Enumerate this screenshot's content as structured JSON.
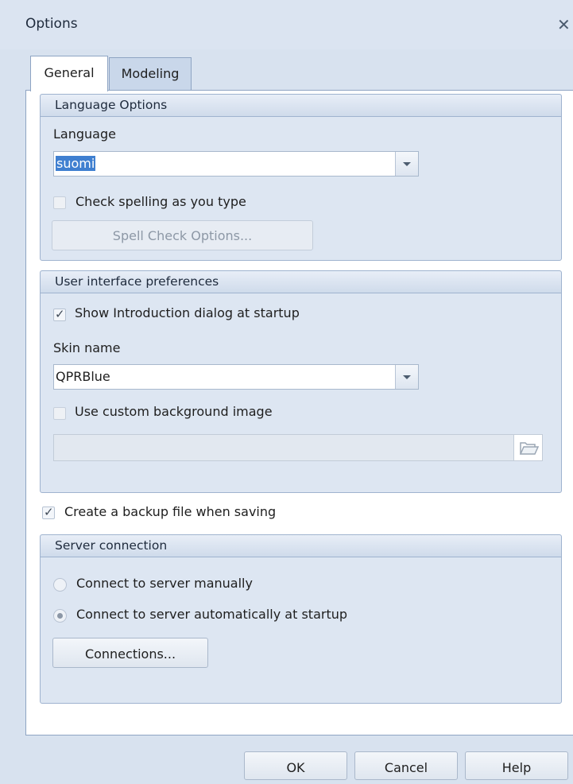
{
  "window": {
    "title": "Options",
    "close_icon": "close-icon"
  },
  "tabs": [
    {
      "label": "General",
      "selected": true
    },
    {
      "label": "Modeling",
      "selected": false
    }
  ],
  "language_options": {
    "header": "Language Options",
    "language_label": "Language",
    "language_value": "suomi",
    "check_spelling_label": "Check spelling as you type",
    "check_spelling_checked": false,
    "spell_check_button": "Spell Check Options..."
  },
  "ui_preferences": {
    "header": "User interface preferences",
    "show_intro_label": "Show Introduction dialog at startup",
    "show_intro_checked": true,
    "skin_label": "Skin name",
    "skin_value": "QPRBlue",
    "custom_bg_label": "Use custom background image",
    "custom_bg_checked": false,
    "bg_path_value": ""
  },
  "backup": {
    "label": "Create a backup file when saving",
    "checked": true
  },
  "server_connection": {
    "header": "Server connection",
    "manual_label": "Connect to server manually",
    "auto_label": "Connect to server automatically at startup",
    "selected": "auto",
    "connections_button": "Connections..."
  },
  "footer": {
    "ok": "OK",
    "cancel": "Cancel",
    "help": "Help"
  },
  "colors": {
    "accent_selection": "#3f7fd0",
    "window_bg": "#d8e2ef",
    "group_bg": "#dde6f2"
  }
}
